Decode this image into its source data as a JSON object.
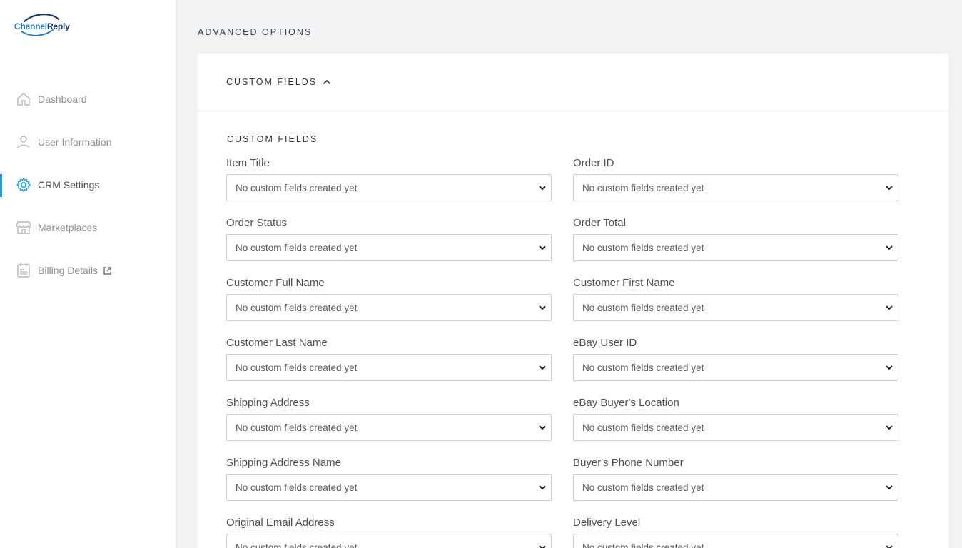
{
  "brand": {
    "name_part1": "Channel",
    "name_part2": "Reply"
  },
  "colors": {
    "accent": "#1aa0e0",
    "brand_blue": "#1f77c9",
    "brand_navy": "#1b3c6e"
  },
  "sidebar": {
    "items": [
      {
        "label": "Dashboard",
        "icon": "home-icon"
      },
      {
        "label": "User Information",
        "icon": "user-icon"
      },
      {
        "label": "CRM Settings",
        "icon": "gear-icon",
        "active": true
      },
      {
        "label": "Marketplaces",
        "icon": "store-icon"
      },
      {
        "label": "Billing Details",
        "icon": "billing-icon",
        "external": true
      }
    ]
  },
  "main": {
    "section_title": "ADVANCED OPTIONS",
    "card": {
      "header_title": "CUSTOM FIELDS",
      "sub_title": "CUSTOM FIELDS",
      "fields": [
        {
          "label": "Item Title",
          "value": "No custom fields created yet"
        },
        {
          "label": "Order ID",
          "value": "No custom fields created yet"
        },
        {
          "label": "Order Status",
          "value": "No custom fields created yet"
        },
        {
          "label": "Order Total",
          "value": "No custom fields created yet"
        },
        {
          "label": "Customer Full Name",
          "value": "No custom fields created yet"
        },
        {
          "label": "Customer First Name",
          "value": "No custom fields created yet"
        },
        {
          "label": "Customer Last Name",
          "value": "No custom fields created yet"
        },
        {
          "label": "eBay User ID",
          "value": "No custom fields created yet"
        },
        {
          "label": "Shipping Address",
          "value": "No custom fields created yet"
        },
        {
          "label": "eBay Buyer's Location",
          "value": "No custom fields created yet"
        },
        {
          "label": "Shipping Address Name",
          "value": "No custom fields created yet"
        },
        {
          "label": "Buyer's Phone Number",
          "value": "No custom fields created yet"
        },
        {
          "label": "Original Email Address",
          "value": "No custom fields created yet"
        },
        {
          "label": "Delivery Level",
          "value": "No custom fields created yet"
        }
      ]
    }
  }
}
